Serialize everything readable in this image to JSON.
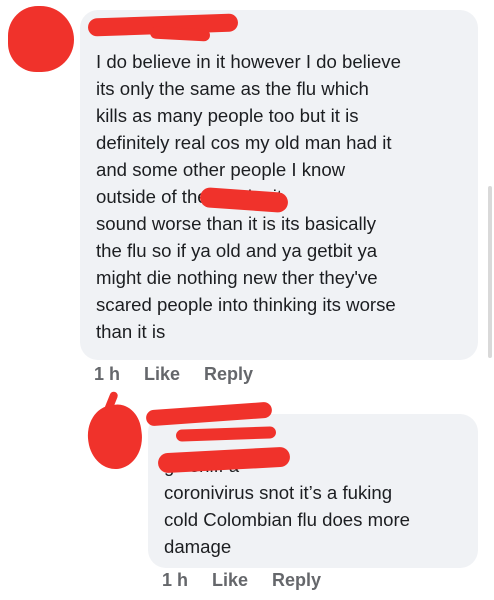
{
  "comments": [
    {
      "text": "I do believe in it however I do believe\nits only the same as the flu which\nkills as many people too but it is\ndefinitely real cos my old man had it\nand some other people I know\noutside of           they make it\nsound worse than it is its basically\nthe flu so if ya old and ya getbit ya\nmight die nothing new ther they've\nscared people into thinking its worse\nthan it is",
      "time": "1 h",
      "like_label": "Like",
      "reply_label": "Reply"
    },
    {
      "text": "                       go sniff a\ncoronivirus snot it’s a fuking\ncold Colombian flu does more\ndamage",
      "time": "1 h",
      "like_label": "Like",
      "reply_label": "Reply"
    }
  ],
  "colors": {
    "bubble": "#f0f2f5",
    "redaction": "#f0322b",
    "meta_text": "#65676b"
  }
}
